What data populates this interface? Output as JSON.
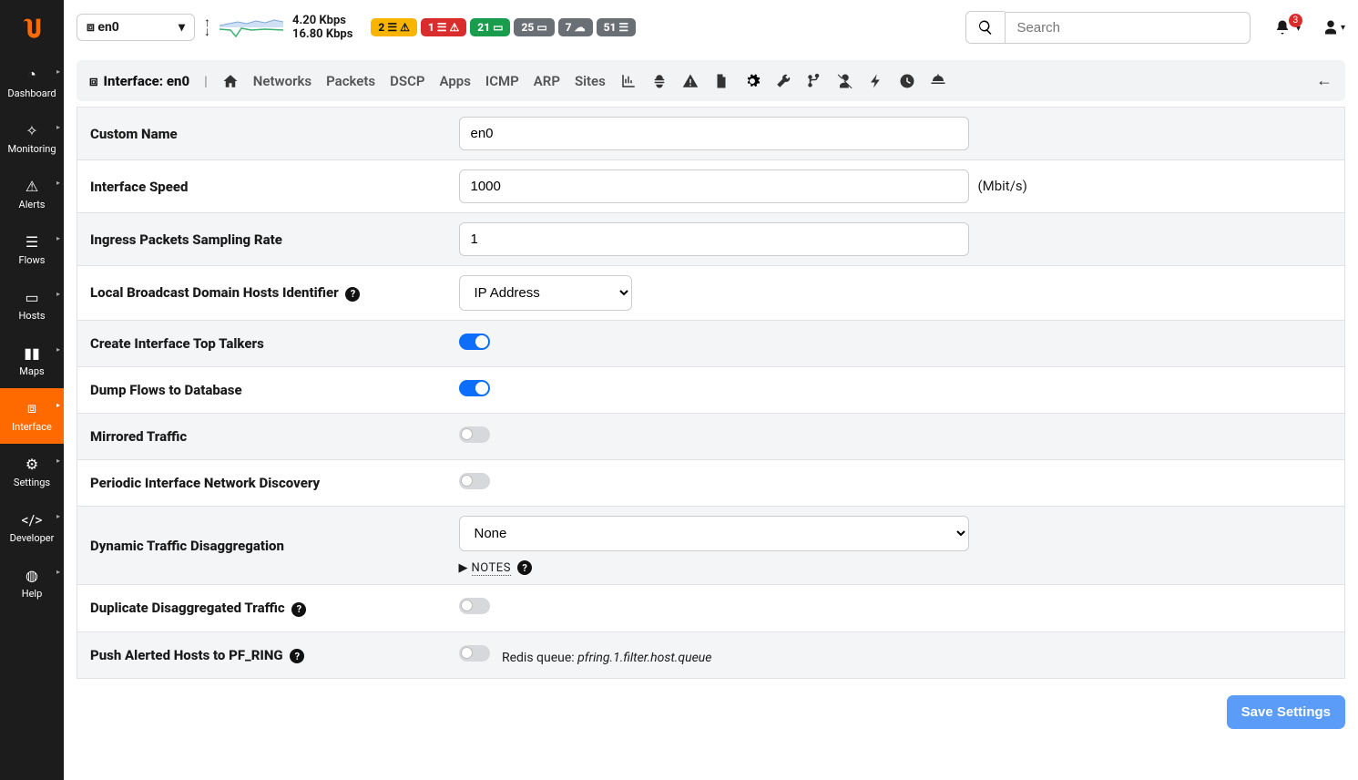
{
  "interface_selector": "en0",
  "rates": {
    "up": "4.20 Kbps",
    "down": "16.80 Kbps"
  },
  "badges": [
    {
      "count": "2",
      "icon": "warning",
      "color": "yellow"
    },
    {
      "count": "1",
      "icon": "warning",
      "color": "red"
    },
    {
      "count": "21",
      "icon": "laptop",
      "color": "green"
    },
    {
      "count": "25",
      "icon": "laptop",
      "color": "gray"
    },
    {
      "count": "7",
      "icon": "cloud",
      "color": "gray"
    },
    {
      "count": "51",
      "icon": "list",
      "color": "gray"
    }
  ],
  "search_placeholder": "Search",
  "notifications": "3",
  "sidebar": [
    {
      "label": "Dashboard"
    },
    {
      "label": "Monitoring"
    },
    {
      "label": "Alerts"
    },
    {
      "label": "Flows"
    },
    {
      "label": "Hosts"
    },
    {
      "label": "Maps"
    },
    {
      "label": "Interface",
      "active": true
    },
    {
      "label": "Settings"
    },
    {
      "label": "Developer"
    },
    {
      "label": "Help"
    }
  ],
  "subbar_title": "Interface: en0",
  "subbar_tabs": [
    "Networks",
    "Packets",
    "DSCP",
    "Apps",
    "ICMP",
    "ARP",
    "Sites"
  ],
  "rows": {
    "custom_name": {
      "label": "Custom Name",
      "value": "en0"
    },
    "speed": {
      "label": "Interface Speed",
      "value": "1000",
      "unit": "(Mbit/s)"
    },
    "sampling": {
      "label": "Ingress Packets Sampling Rate",
      "value": "1"
    },
    "hosts_id": {
      "label": "Local Broadcast Domain Hosts Identifier",
      "value": "IP Address"
    },
    "top_talkers": {
      "label": "Create Interface Top Talkers",
      "on": true
    },
    "dump_flows": {
      "label": "Dump Flows to Database",
      "on": true
    },
    "mirrored": {
      "label": "Mirrored Traffic",
      "on": false
    },
    "discovery": {
      "label": "Periodic Interface Network Discovery",
      "on": false
    },
    "disagg": {
      "label": "Dynamic Traffic Disaggregation",
      "value": "None",
      "notes": "NOTES"
    },
    "dup_disagg": {
      "label": "Duplicate Disaggregated Traffic",
      "on": false
    },
    "pfring": {
      "label": "Push Alerted Hosts to PF_RING",
      "on": false,
      "redis_label": "Redis queue: ",
      "redis_value": "pfring.1.filter.host.queue"
    }
  },
  "save_label": "Save Settings"
}
